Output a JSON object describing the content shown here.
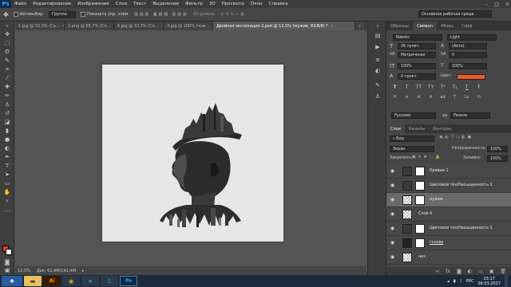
{
  "app": {
    "logo": "Ps"
  },
  "menu": [
    "Файл",
    "Редактирование",
    "Изображение",
    "Слои",
    "Текст",
    "Выделение",
    "Фильтр",
    "3D",
    "Просмотр",
    "Окно",
    "Справка"
  ],
  "window_controls": [
    "–",
    "□",
    "×"
  ],
  "options_bar": {
    "autoselect_label": "Автовыбор:",
    "autoselect_value": "Группа",
    "show_controls_label": "Показать упр. элем.",
    "mode_3d_label": "3D-режим:",
    "workspace": "Основная рабочая среда"
  },
  "doc_tabs": [
    {
      "label": "1.jpg @ 33,3% (Са...",
      "active": false
    },
    {
      "label": "2.png @ 66,7% (Сл...",
      "active": false
    },
    {
      "label": "6.jpg @ 33,3% (Сл...",
      "active": false
    },
    {
      "label": "3.jpg @ 100% (чуж...",
      "active": false
    },
    {
      "label": "Двойная экспозиция 2.psd @ 12,5% (мужик, RGB/8) *",
      "active": true
    }
  ],
  "status": {
    "zoom": "12,5%",
    "doc_size": "Док: 61,4М/141,4М"
  },
  "char_panel": {
    "tabs": [
      "Образцы",
      "Символ",
      "Абзац",
      "Глиф"
    ],
    "active_tab": "Символ",
    "font_family": "Roboto",
    "font_style": "Light",
    "font_size": "36 пункт.",
    "leading": "(Авто)",
    "kerning": "Метрически",
    "tracking": "0",
    "vscale": "100%",
    "hscale": "100%",
    "baseline": "0 пункт.",
    "color_label": "Цвет:",
    "color": "#f05a28",
    "style_buttons": [
      "T",
      "T",
      "TT",
      "Tт",
      "T¹",
      "T₁",
      "T",
      "Ŧ"
    ],
    "extra_buttons": [
      "fi",
      "σ",
      "st",
      "A",
      "ad",
      "T",
      "1st",
      "½"
    ],
    "language": "Русский",
    "aa_label": "aa",
    "aa_mode": "Резкое"
  },
  "layers_panel": {
    "tabs": [
      "Слои",
      "Каналы",
      "Контуры"
    ],
    "active_tab": "Слои",
    "filter": "Вид",
    "blend_mode": "Экран",
    "opacity_label": "Непрозрачность:",
    "opacity": "100%",
    "lock_label": "Закрепить:",
    "fill_label": "Заливка:",
    "fill": "100%",
    "layers": [
      {
        "name": "Кривые 1",
        "type": "adjustment",
        "selected": false
      },
      {
        "name": "Цветовой тон/Насыщенность 2",
        "type": "adjustment",
        "selected": false
      },
      {
        "name": "мужик",
        "type": "masked",
        "selected": true
      },
      {
        "name": "Слой 4",
        "type": "pixel",
        "selected": false
      },
      {
        "name": "Цветовой тон/Насыщенность 1",
        "type": "adjustment",
        "selected": false
      },
      {
        "name": "голова",
        "type": "masked",
        "selected": false
      },
      {
        "name": "низ",
        "type": "pixel",
        "selected": false
      }
    ]
  },
  "taskbar": {
    "apps": [
      "Explorer",
      "Ai",
      "Chrome",
      "Telegram",
      "Skype",
      "Ps"
    ],
    "lang": "РУС",
    "time": "23:17",
    "date": "26.03.2017"
  }
}
